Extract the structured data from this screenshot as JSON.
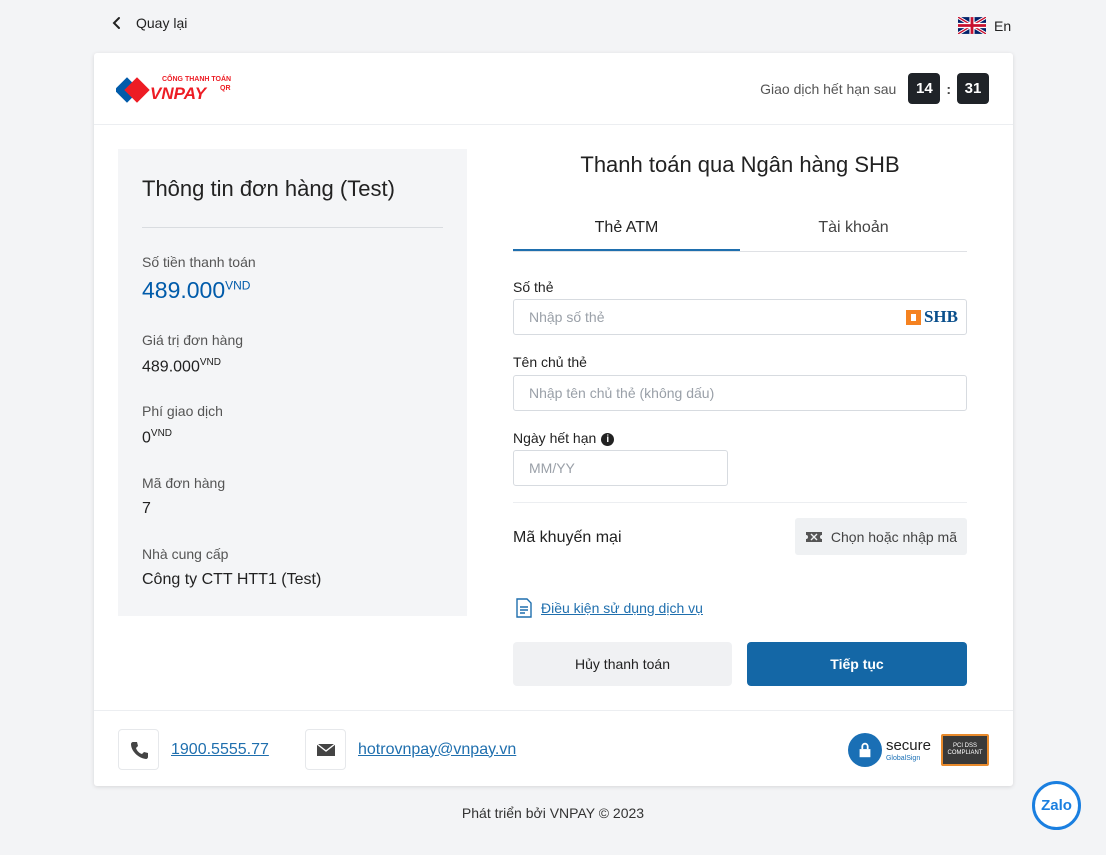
{
  "nav": {
    "back_label": "Quay lại",
    "lang_label": "En"
  },
  "header": {
    "logo_top_text": "CỔNG THANH TOÁN",
    "logo_brand": "VNPAY",
    "logo_qr": "QR",
    "timer_label": "Giao dịch hết hạn sau",
    "timer_minutes": "14",
    "timer_separator": ":",
    "timer_seconds": "31"
  },
  "order": {
    "title": "Thông tin đơn hàng (Test)",
    "fields": [
      {
        "label": "Số tiền thanh toán",
        "value": "489.000",
        "unit": "VND"
      },
      {
        "label": "Giá trị đơn hàng",
        "value": "489.000",
        "unit": "VND"
      },
      {
        "label": "Phí giao dịch",
        "value": "0",
        "unit": "VND"
      },
      {
        "label": "Mã đơn hàng",
        "value": "7"
      },
      {
        "label": "Nhà cung cấp",
        "value": "Công ty CTT HTT1 (Test)"
      }
    ]
  },
  "payment": {
    "title": "Thanh toán qua Ngân hàng SHB",
    "tabs": [
      {
        "label": "Thẻ ATM",
        "active": true
      },
      {
        "label": "Tài khoản",
        "active": false
      }
    ],
    "card_number": {
      "label": "Số thẻ",
      "placeholder": "Nhập số thẻ",
      "value": ""
    },
    "bank_logo": "SHB",
    "card_holder": {
      "label": "Tên chủ thẻ",
      "placeholder": "Nhập tên chủ thẻ (không dấu)",
      "value": ""
    },
    "expiry": {
      "label": "Ngày hết hạn",
      "placeholder": "MM/YY",
      "value": ""
    },
    "info_icon_glyph": "i",
    "promo_label": "Mã khuyến mại",
    "promo_button": "Chọn hoặc nhập mã",
    "terms_link": "Điều kiện sử dụng dịch vụ",
    "cancel_button": "Hủy thanh toán",
    "continue_button": "Tiếp tục"
  },
  "footer": {
    "phone": "1900.5555.77",
    "email": "hotrovnpay@vnpay.vn",
    "secure_title": "secure",
    "secure_sub": "GlobalSign",
    "pci_line1": "PCI DSS",
    "pci_line2": "COMPLIANT",
    "credit": "Phát triển bởi VNPAY © 2023",
    "zalo_label": "Zalo"
  },
  "colors": {
    "primary": "#1467a6",
    "link": "#1f6fae",
    "amount": "#005baa",
    "timer_bg": "#1f2328",
    "page_bg": "#f3f4f6"
  }
}
